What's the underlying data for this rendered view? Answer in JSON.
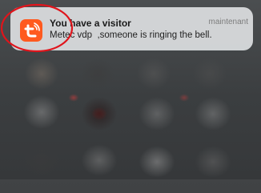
{
  "notification": {
    "app_icon": "tuya-smart-icon",
    "app_icon_color": "#ff5a1f",
    "title": "You have a visitor",
    "time": "maintenant",
    "message": "Metec vdp  ,someone is ringing the bell."
  },
  "annotation": {
    "circle_color": "#e0141b"
  }
}
